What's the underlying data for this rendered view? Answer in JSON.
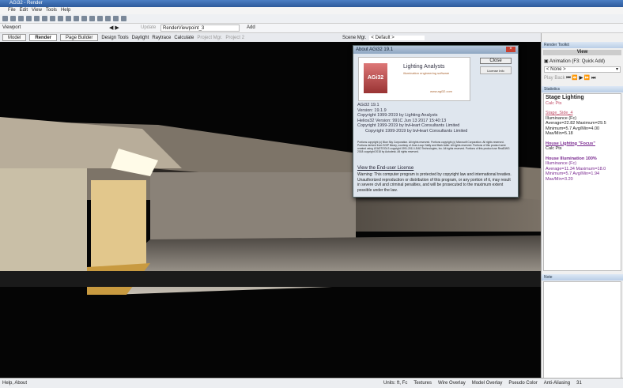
{
  "window": {
    "title": "AGi32 - Render"
  },
  "menu": [
    "File",
    "Edit",
    "View",
    "Tools",
    "Help"
  ],
  "viewport_bar": {
    "label": "Viewport",
    "update": "Update",
    "viewport_name": "RenderViewpoint_3",
    "add": "Add",
    "scene_mgr": "Scene Mgr.",
    "scene_value": "< Default >"
  },
  "tabs": [
    {
      "label": "Model",
      "active": false
    },
    {
      "label": "Render",
      "active": true
    },
    {
      "label": "Page Builder",
      "active": false
    }
  ],
  "tools": [
    "Design Tools",
    "Daylight",
    "Raytrace",
    "Calculate",
    "Project Mgr.",
    "Project 2"
  ],
  "dialog": {
    "title": "About AGi32 19.1",
    "close": "Close",
    "license": "License Info",
    "logo_text": "AGi32",
    "brand": "Lighting Analysts",
    "brand_sub": "illumination engineering software",
    "url": "www.agi32.com",
    "lines": [
      "AGi32 19.1",
      "Version: 19.1.9",
      "Copyright 1999-2019 by Lighting Analysts",
      "Helios32 Version: 991C Jun 13 2017 15:40:13",
      "Copyright 1999-2019 by bvHeart Consultants Limited",
      "Copyright 1999-2019 by bvHeart Consultants Limited"
    ],
    "fine_print": "Portions copyright (c) Blue Sky Corporation. All rights reserved. Portions copyright (c) Microsoft Corporation. All rights reserved. Portions derived from SGIP library, courtesy of Jean-Loup Gailly and Mark Adler. All rights reserved. Portions of this product were created using LEADTOOLS copyright 1991-2011 LEAD Technologies, Inc. All rights reserved. Portions of this product use RealDWG 2018 copyright 2018 by Autodesk. All rights reserved.",
    "eula_link": "View the End-user License",
    "warning": "Warning: This computer program is protected by copyright law and international treaties. Unauthorized reproduction or distribution of this program, or any portion of it, may result in severe civil and criminal penalties, and will be prosecuted to the maximum extent possible under the law."
  },
  "render_toolkit": {
    "title": "Render Toolkit",
    "view": "View",
    "animation": "Animation (F3: Quick Add)",
    "select": "< None >",
    "play_back": "Play Back"
  },
  "statistics": {
    "title": "Statistics",
    "items": [
      {
        "head": "Stage Lighting",
        "sub": "Calc Pts"
      },
      {
        "name": "Stage_Side_4",
        "lines": [
          "Illuminance (Fc)",
          "Average=22.82  Maximum=29.5",
          "Minimum=5.7  Avg/Min=4.00",
          "Max/Min=5.18"
        ]
      },
      {
        "head": "House Lighting \"Focus\"",
        "sub": "Calc Pts"
      },
      {
        "head": "House Illumination 100%",
        "lines": [
          "Illuminance (Fc)",
          "Average=11.34  Maximum=18.0",
          "Minimum=5.7  Avg/Min=1.94",
          "Max/Min=3.20"
        ]
      }
    ]
  },
  "note_panel": {
    "title": "Note"
  },
  "status": {
    "left": "Help, About",
    "items": [
      "Units: ft, Fc",
      "Textures",
      "Wire Overlay",
      "Model Overlay",
      "Pseudo Color",
      "Anti-Aliasing"
    ],
    "aa_value": "31"
  }
}
